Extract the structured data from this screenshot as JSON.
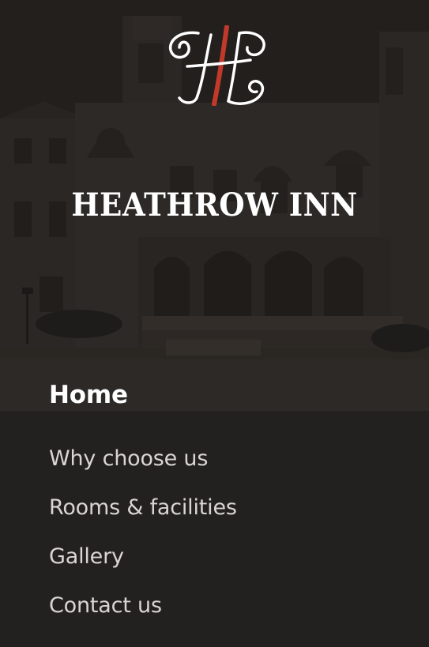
{
  "brand": {
    "name": "HEATHROW INN",
    "logo_icon": "hh-monogram-logo-icon",
    "logo_accent_color": "#c0392b"
  },
  "menu": {
    "items": [
      {
        "label": "Home",
        "active": true
      },
      {
        "label": "Why choose us",
        "active": false
      },
      {
        "label": "Rooms & facilities",
        "active": false
      },
      {
        "label": "Gallery",
        "active": false
      },
      {
        "label": "Contact us",
        "active": false
      }
    ]
  },
  "colors": {
    "background": "#232120",
    "text": "#d9d6d2",
    "active_text": "#ffffff"
  }
}
